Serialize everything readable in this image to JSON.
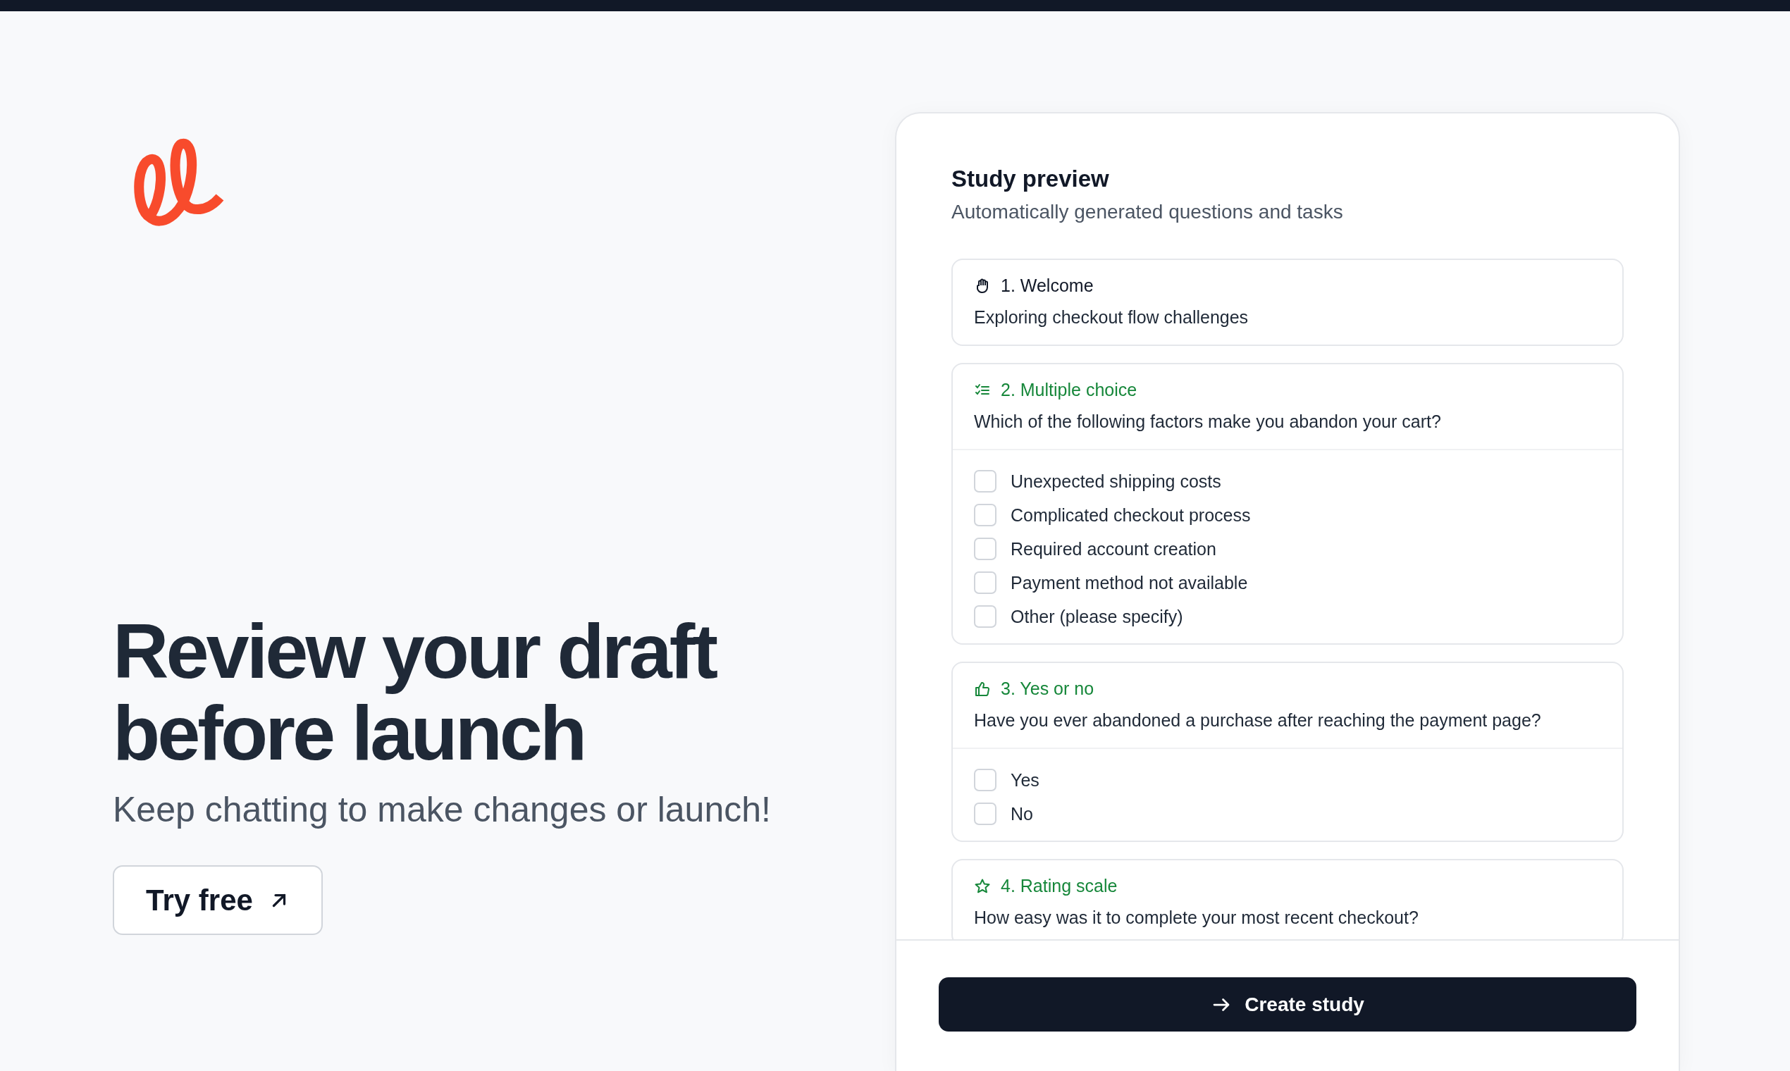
{
  "hero": {
    "title_lines": [
      "Review your draft",
      "before launch"
    ],
    "subtitle": "Keep chatting to make changes or launch!",
    "cta": "Try free"
  },
  "preview": {
    "title": "Study preview",
    "subtitle": "Automatically generated questions and tasks",
    "items": [
      {
        "kind": "welcome",
        "label": "1. Welcome",
        "text": "Exploring checkout flow challenges"
      },
      {
        "kind": "multiple_choice",
        "label": "2. Multiple choice",
        "text": "Which of the following factors make you abandon your cart?",
        "options": [
          {
            "label": "Unexpected shipping costs",
            "checked": false
          },
          {
            "label": "Complicated checkout process",
            "checked": false
          },
          {
            "label": "Required account creation",
            "checked": false
          },
          {
            "label": "Payment method not available",
            "checked": false
          },
          {
            "label": "Other (please specify)",
            "checked": false
          }
        ]
      },
      {
        "kind": "yes_no",
        "label": "3. Yes or no",
        "text": "Have you ever abandoned a purchase after reaching the payment page?",
        "options": [
          {
            "label": "Yes",
            "checked": false
          },
          {
            "label": "No",
            "checked": false
          }
        ]
      },
      {
        "kind": "rating",
        "label": "4. Rating scale",
        "text": "How easy was it to complete your most recent checkout?"
      }
    ],
    "action": "Create study"
  }
}
